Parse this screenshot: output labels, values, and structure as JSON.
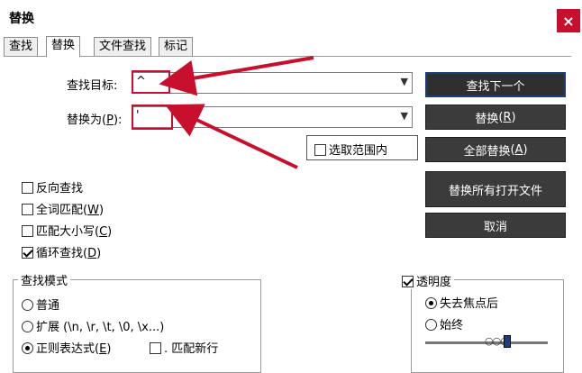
{
  "window": {
    "title": "替换",
    "close_glyph": "×"
  },
  "tabs": [
    {
      "label": "查找",
      "active": false
    },
    {
      "label": "替换",
      "active": true
    },
    {
      "label": "文件查找",
      "active": false
    },
    {
      "label": "标记",
      "active": false
    }
  ],
  "find": {
    "label_text": "查找目标",
    "label_sep": ":",
    "value": "^"
  },
  "replace": {
    "label_text": "替换为",
    "label_key": "P",
    "label_sep": ":",
    "value": "'"
  },
  "in_selection": {
    "label": "选取范围内",
    "checked": false
  },
  "buttons": {
    "find_next": "查找下一个",
    "replace": "替换",
    "replace_key": "R",
    "replace_all": "全部替换",
    "replace_all_key": "A",
    "replace_in_open": "替换所有打开文件",
    "cancel": "取消"
  },
  "options": {
    "backward": {
      "label": "反向查找",
      "checked": false
    },
    "whole_word": {
      "label": "全词匹配",
      "key": "W",
      "checked": false
    },
    "match_case": {
      "label": "匹配大小写",
      "key": "C",
      "checked": false
    },
    "wrap": {
      "label": "循环查找",
      "key": "D",
      "checked": true
    }
  },
  "search_mode": {
    "title": "查找模式",
    "normal": {
      "label": "普通",
      "checked": false
    },
    "extended": {
      "label": "扩展",
      "hint": "(\\n, \\r, \\t, \\0, \\x...)",
      "checked": false
    },
    "regex": {
      "label": "正则表达式",
      "key": "E",
      "checked": true
    },
    "dot_newline": {
      "label": ". 匹配新行",
      "checked": false
    }
  },
  "transparency": {
    "title": "透明度",
    "checked": true,
    "on_lose_focus": {
      "label": "失去焦点后",
      "checked": true
    },
    "always": {
      "label": "始终",
      "checked": false
    },
    "level": 0.68
  },
  "colors": {
    "highlight": "#c8102e",
    "button_bg": "#3b3b3b",
    "arrow": "#c8102e"
  }
}
